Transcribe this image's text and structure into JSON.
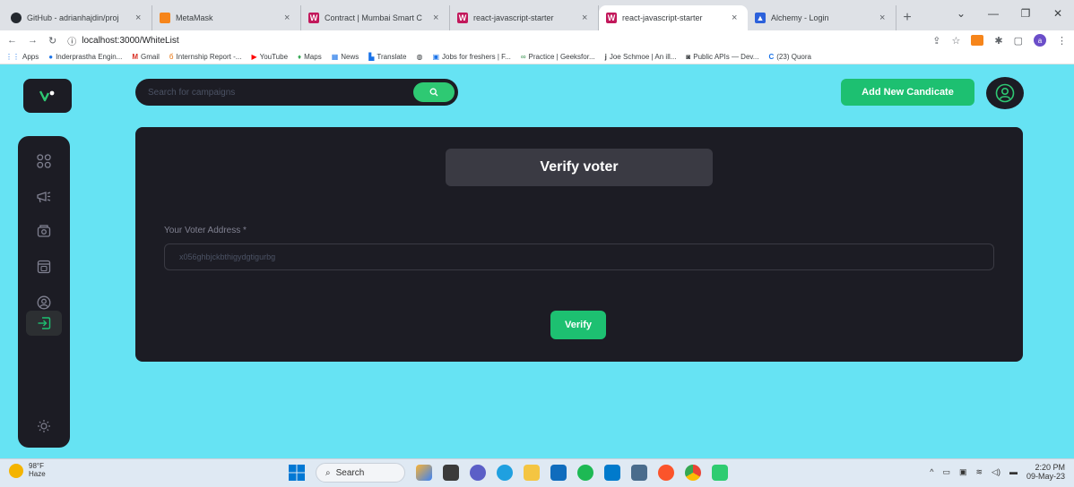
{
  "browser": {
    "tabs": [
      {
        "title": "GitHub - adrianhajdin/proj",
        "favicon": "github-icon",
        "color": "#24292f"
      },
      {
        "title": "MetaMask",
        "favicon": "metamask-icon",
        "color": "#f6851b"
      },
      {
        "title": "Contract | Mumbai Smart C",
        "favicon": "w-icon",
        "color": "#c2185b"
      },
      {
        "title": "react-javascript-starter",
        "favicon": "w-icon",
        "color": "#c2185b"
      },
      {
        "title": "react-javascript-starter",
        "favicon": "w-icon",
        "color": "#c2185b",
        "active": true
      },
      {
        "title": "Alchemy - Login",
        "favicon": "alchemy-icon",
        "color": "#2c61db"
      }
    ],
    "new_tab": "+",
    "url": "localhost:3000/WhiteList",
    "bookmarks": [
      "Apps",
      "Inderprastha Engin...",
      "Gmail",
      "Internship Report -...",
      "YouTube",
      "Maps",
      "News",
      "Translate",
      "Jobs for freshers | F...",
      "Practice | Geeksfor...",
      "Joe Schmoe | An ill...",
      "Public APIs — Dev...",
      "(23) Quora"
    ],
    "profile_letter": "a"
  },
  "app": {
    "search": {
      "placeholder": "Search for campaigns"
    },
    "add_button_label": "Add New Candicate",
    "sidebar": {
      "items": [
        {
          "icon": "dashboard-icon",
          "active": false
        },
        {
          "icon": "campaign-icon",
          "active": false
        },
        {
          "icon": "payment-icon",
          "active": false
        },
        {
          "icon": "withdraw-icon",
          "active": false
        },
        {
          "icon": "profile-icon",
          "active": false
        },
        {
          "icon": "logout-icon",
          "active": true
        }
      ],
      "theme_icon": "sun-icon"
    },
    "panel": {
      "title": "Verify voter",
      "field_label": "Your Voter Address *",
      "field_placeholder": "x056ghbjckbthigydgtigurbg",
      "button_label": "Verify"
    },
    "colors": {
      "accent": "#1dc071",
      "panel": "#1c1c24",
      "background": "#66e3f3"
    }
  },
  "taskbar": {
    "weather_temp": "98°F",
    "weather_desc": "Haze",
    "search_label": "Search",
    "time": "2:20 PM",
    "date": "09-May-23"
  }
}
